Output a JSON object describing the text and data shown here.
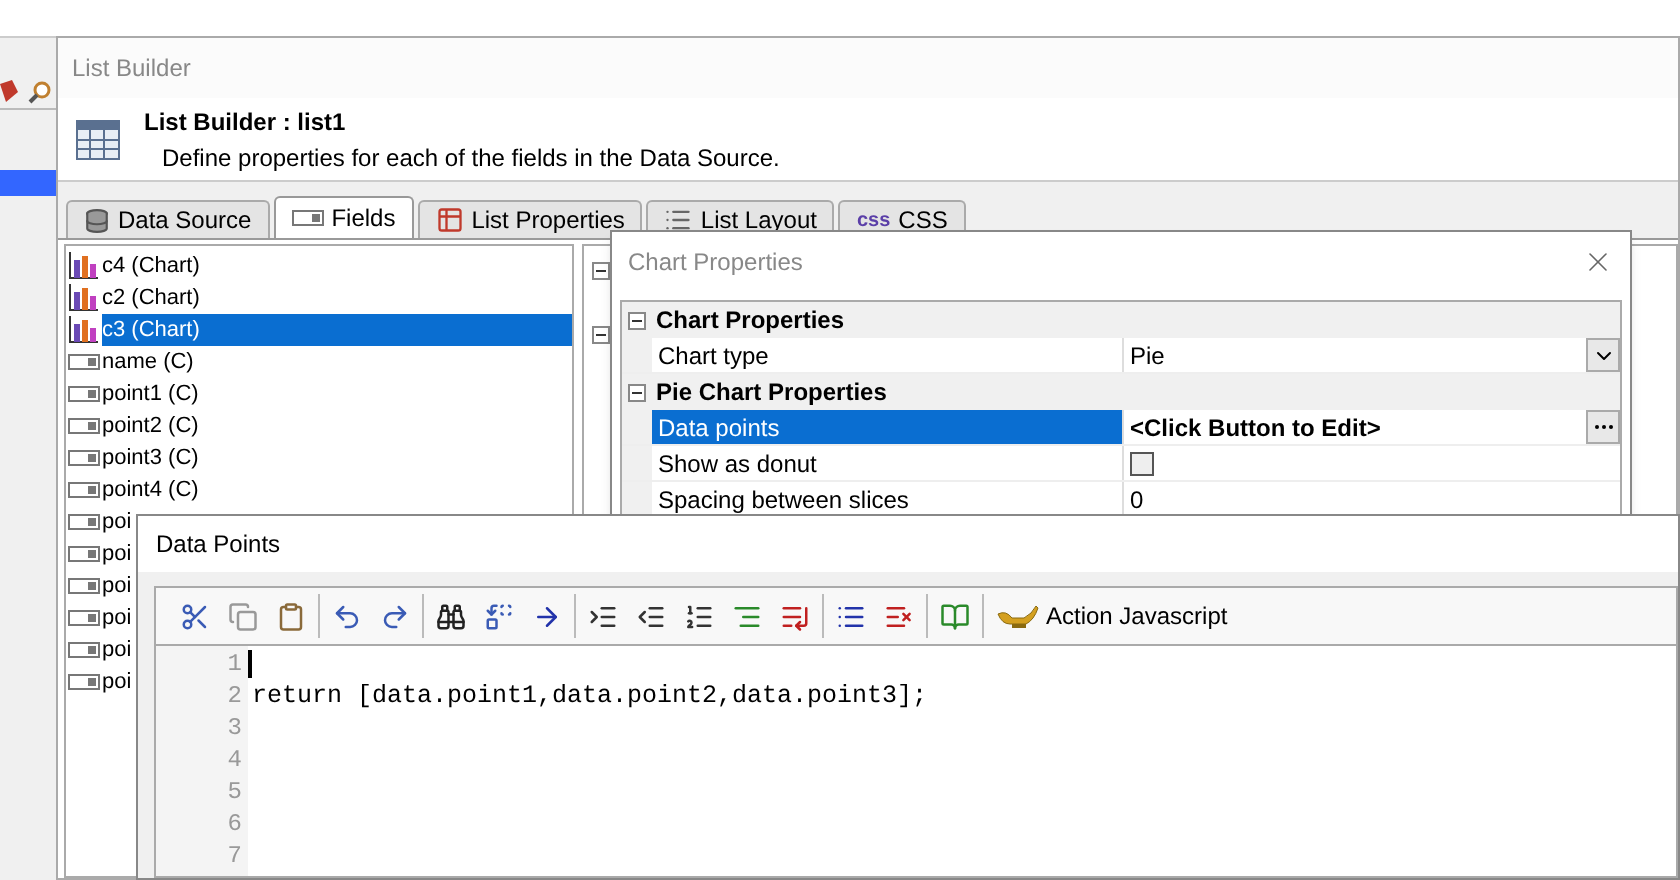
{
  "list_builder": {
    "title": "List Builder",
    "header": {
      "title": "List Builder : list1",
      "description": "Define properties for each of the fields in the Data Source."
    },
    "tabs": [
      {
        "label": "Data Source",
        "kind": "database",
        "selected": false
      },
      {
        "label": "Fields",
        "kind": "field",
        "selected": true
      },
      {
        "label": "List Properties",
        "kind": "properties",
        "selected": false
      },
      {
        "label": "List Layout",
        "kind": "layout",
        "selected": false
      },
      {
        "label": "CSS",
        "kind": "css",
        "icon_text": "css",
        "selected": false
      }
    ],
    "fields": [
      {
        "label": "c4 (Chart)",
        "kind": "chart",
        "selected": false
      },
      {
        "label": "c2 (Chart)",
        "kind": "chart",
        "selected": false
      },
      {
        "label": "c3 (Chart)",
        "kind": "chart",
        "selected": true
      },
      {
        "label": "name (C)",
        "kind": "column",
        "selected": false
      },
      {
        "label": "point1 (C)",
        "kind": "column",
        "selected": false
      },
      {
        "label": "point2 (C)",
        "kind": "column",
        "selected": false
      },
      {
        "label": "point3 (C)",
        "kind": "column",
        "selected": false
      },
      {
        "label": "point4 (C)",
        "kind": "column",
        "selected": false
      },
      {
        "label": "poi",
        "kind": "column",
        "selected": false
      },
      {
        "label": "poi",
        "kind": "column",
        "selected": false
      },
      {
        "label": "poi",
        "kind": "column",
        "selected": false
      },
      {
        "label": "poi",
        "kind": "column",
        "selected": false
      },
      {
        "label": "poi",
        "kind": "column",
        "selected": false
      },
      {
        "label": "poi",
        "kind": "column",
        "selected": false
      }
    ]
  },
  "chart_properties": {
    "title": "Chart Properties",
    "groups": [
      {
        "title": "Chart Properties",
        "expanded": true,
        "rows": [
          {
            "name": "Chart type",
            "value": "Pie",
            "kind": "dropdown",
            "selected": false
          }
        ]
      },
      {
        "title": "Pie Chart Properties",
        "expanded": true,
        "rows": [
          {
            "name": "Data points",
            "value": "<Click Button to Edit>",
            "kind": "button",
            "selected": true
          },
          {
            "name": "Show as donut",
            "kind": "checkbox",
            "checked": false,
            "selected": false
          },
          {
            "name": "Spacing between slices",
            "value": "0",
            "kind": "text",
            "selected": false
          }
        ]
      }
    ]
  },
  "data_points": {
    "title": "Data Points",
    "action_label": "Action Javascript",
    "lines": [
      {
        "number": "1",
        "cursor": true
      },
      {
        "number": "2",
        "text": "return [data.point1,data.point2,data.point3];",
        "cursor": false
      },
      {
        "number": "3",
        "cursor": false
      },
      {
        "number": "4",
        "cursor": false
      },
      {
        "number": "5",
        "cursor": false
      },
      {
        "number": "6",
        "cursor": false
      },
      {
        "number": "7",
        "cursor": false
      }
    ]
  }
}
